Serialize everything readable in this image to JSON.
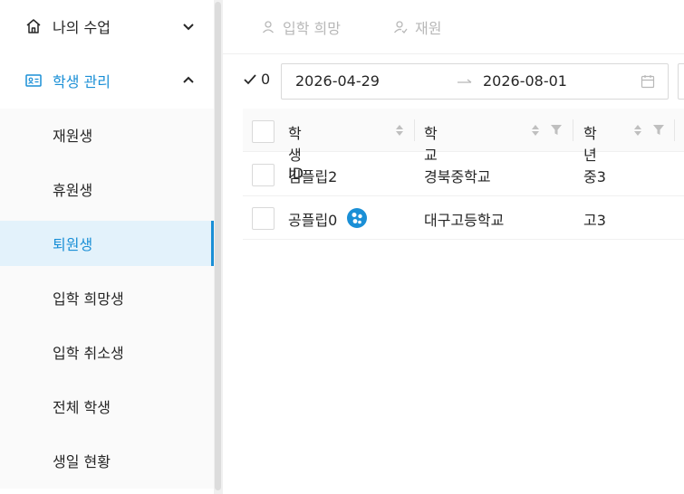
{
  "sidebar": {
    "menu_my_classes": "나의 수업",
    "menu_student_mgmt": "학생 관리",
    "sub_items": [
      "재원생",
      "휴원생",
      "퇴원생",
      "입학 희망생",
      "입학 취소생",
      "전체 학생",
      "생일 현황"
    ],
    "active_sub": "퇴원생"
  },
  "tabs": {
    "tab1": "입학 희망",
    "tab2": "재원"
  },
  "filter": {
    "check_count": "0",
    "date_start": "2026-04-29",
    "date_end": "2026-08-01"
  },
  "table": {
    "headers": {
      "student_id": "학생ID",
      "school": "학교",
      "grade": "학년"
    },
    "rows": [
      {
        "student_id": "김플립2",
        "school": "경북중학교",
        "grade": "중3"
      },
      {
        "student_id": "공플립0",
        "school": "대구고등학교",
        "grade": "고3"
      }
    ]
  },
  "colors": {
    "accent": "#1a8fd6",
    "active_bg": "#e3f2fb",
    "muted": "#b8b8b8"
  },
  "icons": [
    "home-icon",
    "chevron-down-icon",
    "id-card-icon",
    "chevron-up-icon",
    "user-icon",
    "user-check-icon",
    "check-icon",
    "arrow-right-icon",
    "calendar-icon",
    "sort-icon",
    "filter-icon",
    "group-badge-icon"
  ]
}
